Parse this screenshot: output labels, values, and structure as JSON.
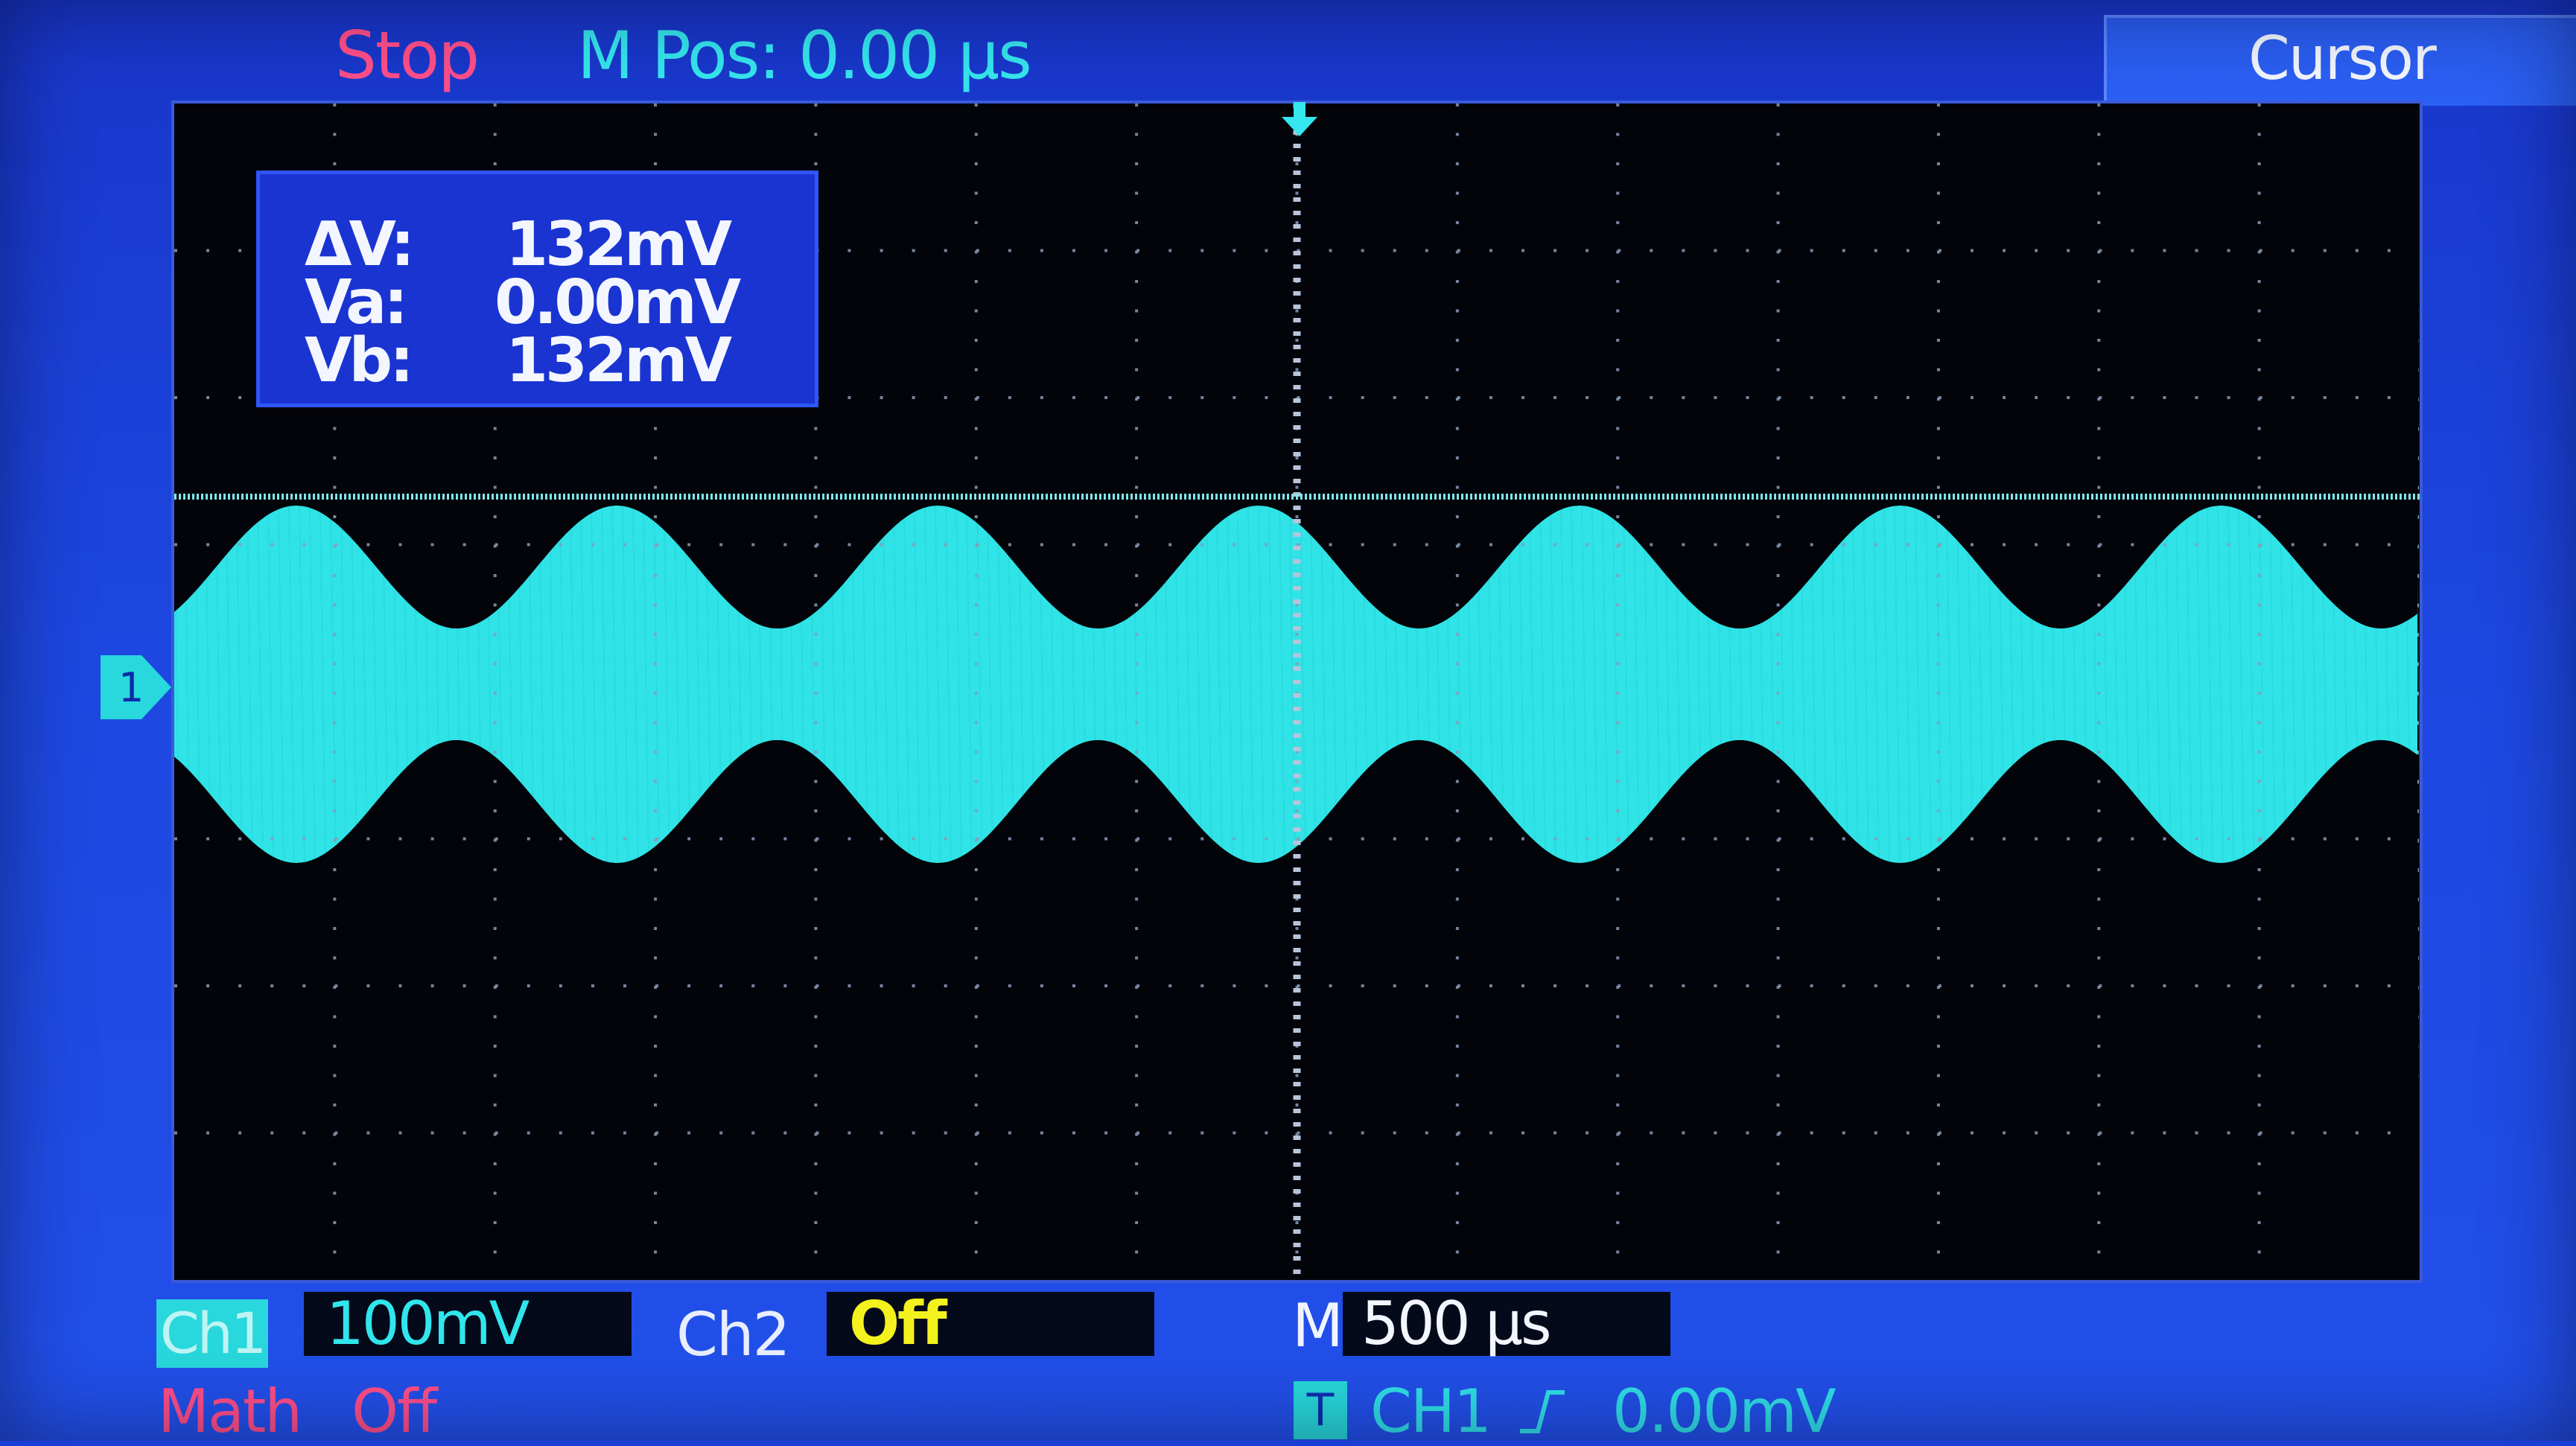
{
  "header": {
    "run_state": "Stop",
    "mpos_label": "M Pos:",
    "mpos_value": "0.00 µs",
    "menu_title": "Cursor"
  },
  "cursor_readout": {
    "delta_label": "ΔV:",
    "delta_value": "132mV",
    "va_label": "Va:",
    "va_value": "0.00mV",
    "vb_label": "Vb:",
    "vb_value": "132mV"
  },
  "channels": {
    "ch1_label": "Ch1",
    "ch1_scale": "100mV",
    "ch2_label": "Ch2",
    "ch2_state": "Off",
    "math_label": "Math",
    "math_state": "Off"
  },
  "timebase": {
    "label": "M",
    "value": "500 µs"
  },
  "trigger": {
    "icon_text": "T",
    "source": "CH1",
    "slope_icon": "rising-edge-icon",
    "level": "0.00mV"
  },
  "colors": {
    "background": "#1d47e0",
    "grid_bg": "#020409",
    "trace": "#2fe3e6",
    "stop": "#ff4f8a",
    "ch2_off": "#f4f21e",
    "readout_bg": "#1a34d2"
  },
  "waveform": {
    "type": "amplitude-modulated sine",
    "envelope_cycles_visible": 7,
    "carrier_fills_envelope": true
  }
}
